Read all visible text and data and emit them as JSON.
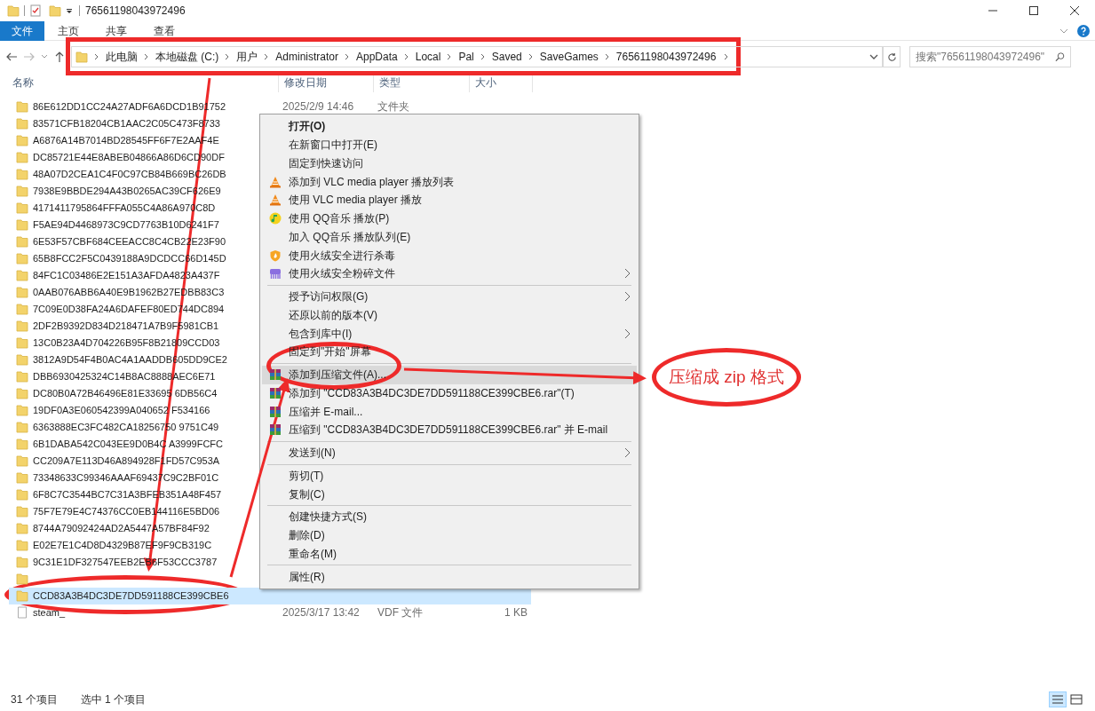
{
  "window": {
    "title": "76561198043972496"
  },
  "ribbon_tabs": [
    {
      "label": "文件",
      "selected": true
    },
    {
      "label": "主页",
      "selected": false
    },
    {
      "label": "共享",
      "selected": false
    },
    {
      "label": "查看",
      "selected": false
    }
  ],
  "address": {
    "crumbs": [
      "此电脑",
      "本地磁盘 (C:)",
      "用户",
      "Administrator",
      "AppData",
      "Local",
      "Pal",
      "Saved",
      "SaveGames",
      "76561198043972496"
    ]
  },
  "search": {
    "placeholder": "搜索\"76561198043972496\""
  },
  "columns": [
    "名称",
    "修改日期",
    "类型",
    "大小"
  ],
  "files": [
    {
      "kind": "folder",
      "name": "86E612DD1CC24A27ADF6A6DCD1B91752",
      "date": "2025/2/9 14:46",
      "type": "文件夹",
      "selected": false
    },
    {
      "kind": "folder",
      "name": "83571CFB18204CB1AAC2C05C473F8733",
      "selected": false
    },
    {
      "kind": "folder",
      "name": "A6876A14B7014BD28545FF6F7E2AAF4E",
      "selected": false
    },
    {
      "kind": "folder",
      "name": "DC85721E44E8ABEB04866A86D6CD90DF",
      "selected": false
    },
    {
      "kind": "folder",
      "name": "48A07D2CEA1C4F0C97CB84B669BC26DB",
      "selected": false
    },
    {
      "kind": "folder",
      "name": "7938E9BBDE294A43B0265AC39CF626E9",
      "selected": false
    },
    {
      "kind": "folder",
      "name": "4171411795864FFFA055C4A86A970C8D",
      "selected": false
    },
    {
      "kind": "folder",
      "name": "F5AE94D4468973C9CD7763B10D6241F7",
      "selected": false
    },
    {
      "kind": "folder",
      "name": "6E53F57CBF684CEEACC8C4CB22E23F90",
      "selected": false
    },
    {
      "kind": "folder",
      "name": "65B8FCC2F5C0439188A9DCDCC66D145D",
      "selected": false
    },
    {
      "kind": "folder",
      "name": "84FC1C03486E2E151A3AFDA4823A437F",
      "selected": false
    },
    {
      "kind": "folder",
      "name": "0AAB076ABB6A40E9B1962B27EDBB83C3",
      "selected": false
    },
    {
      "kind": "folder",
      "name": "7C09E0D38FA24A6DAFEF80ED744DC894",
      "selected": false
    },
    {
      "kind": "folder",
      "name": "2DF2B9392D834D218471A7B9F5981CB1",
      "selected": false
    },
    {
      "kind": "folder",
      "name": "13C0B23A4D704226B95F8B21809CCD03",
      "selected": false
    },
    {
      "kind": "folder",
      "name": "3812A9D54F4B0AC4A1AADDB605DD9CE2",
      "selected": false
    },
    {
      "kind": "folder",
      "name": "DBB6930425324C14B8AC8888AEC6E71",
      "selected": false
    },
    {
      "kind": "folder",
      "name": "DC80B0A72B46496E81E33695 6DB56C4",
      "selected": false
    },
    {
      "kind": "folder",
      "name": "19DF0A3E060542399A040652 F534166",
      "selected": false
    },
    {
      "kind": "folder",
      "name": "6363888EC3FC482CA18256750 9751C49",
      "selected": false
    },
    {
      "kind": "folder",
      "name": "6B1DABA542C043EE9D0B4C A3999FCFC",
      "selected": false
    },
    {
      "kind": "folder",
      "name": "CC209A7E113D46A894928F1FD57C953A",
      "selected": false
    },
    {
      "kind": "folder",
      "name": "73348633C99346AAAF69437C9C2BF01C",
      "selected": false
    },
    {
      "kind": "folder",
      "name": "6F8C7C3544BC7C31A3BFEB351A48F457",
      "selected": false
    },
    {
      "kind": "folder",
      "name": "75F7E79E4C74376CC0EB144116E5BD06",
      "selected": false
    },
    {
      "kind": "folder",
      "name": "8744A79092424AD2A5447A57BF84F92",
      "selected": false
    },
    {
      "kind": "folder",
      "name": "E02E7E1C4D8D4329B87EF9F9CB319C",
      "selected": false
    },
    {
      "kind": "folder",
      "name": "9C31E1DF327547EEB2EB6F53CCC3787",
      "selected": false
    },
    {
      "kind": "folder",
      "selected": false
    },
    {
      "kind": "folder",
      "name": "CCD83A3B4DC3DE7DD591188CE399CBE6",
      "selected": true
    },
    {
      "kind": "file",
      "name": "steam_",
      "date": "2025/3/17 13:42",
      "type": "VDF 文件",
      "size": "1 KB",
      "selected": false
    }
  ],
  "context_menu": {
    "items": [
      {
        "kind": "plain",
        "label": "打开(O)",
        "default": true,
        "submenu": false,
        "selected": false
      },
      {
        "kind": "plain",
        "label": "在新窗口中打开(E)",
        "default": false,
        "submenu": false,
        "selected": false
      },
      {
        "kind": "plain",
        "label": "固定到快速访问",
        "default": false,
        "submenu": false,
        "selected": false
      },
      {
        "kind": "cone",
        "label": "添加到 VLC media player 播放列表",
        "default": false,
        "submenu": false,
        "selected": false
      },
      {
        "kind": "cone",
        "label": "使用 VLC media player 播放",
        "default": false,
        "submenu": false,
        "selected": false
      },
      {
        "kind": "note",
        "label": "使用 QQ音乐 播放(P)",
        "default": false,
        "submenu": false,
        "selected": false
      },
      {
        "kind": "plain",
        "label": "加入 QQ音乐 播放队列(E)",
        "default": false,
        "submenu": false,
        "selected": false
      },
      {
        "kind": "shield",
        "label": "使用火绒安全进行杀毒",
        "default": false,
        "submenu": false,
        "selected": false
      },
      {
        "kind": "shredder",
        "label": "使用火绒安全粉碎文件",
        "default": false,
        "submenu": true,
        "selected": false
      },
      {
        "kind": "separator"
      },
      {
        "kind": "plain",
        "label": "授予访问权限(G)",
        "default": false,
        "submenu": true,
        "selected": false
      },
      {
        "kind": "plain",
        "label": "还原以前的版本(V)",
        "default": false,
        "submenu": false,
        "selected": false
      },
      {
        "kind": "plain",
        "label": "包含到库中(I)",
        "default": false,
        "submenu": true,
        "selected": false
      },
      {
        "kind": "plain",
        "label": "固定到\"开始\"屏幕",
        "default": false,
        "submenu": false,
        "selected": false
      },
      {
        "kind": "separator"
      },
      {
        "kind": "archive",
        "label": "添加到压缩文件(A)...",
        "default": false,
        "submenu": false,
        "selected": true
      },
      {
        "kind": "archive",
        "label": "添加到 \"CCD83A3B4DC3DE7DD591188CE399CBE6.rar\"(T)",
        "default": false,
        "submenu": false,
        "selected": false
      },
      {
        "kind": "archive",
        "label": "压缩并 E-mail...",
        "default": false,
        "submenu": false,
        "selected": false
      },
      {
        "kind": "archive",
        "label": "压缩到 \"CCD83A3B4DC3DE7DD591188CE399CBE6.rar\" 并 E-mail",
        "default": false,
        "submenu": false,
        "selected": false
      },
      {
        "kind": "separator"
      },
      {
        "kind": "plain",
        "label": "发送到(N)",
        "default": false,
        "submenu": true,
        "selected": false
      },
      {
        "kind": "separator"
      },
      {
        "kind": "plain",
        "label": "剪切(T)",
        "default": false,
        "submenu": false,
        "selected": false
      },
      {
        "kind": "plain",
        "label": "复制(C)",
        "default": false,
        "submenu": false,
        "selected": false
      },
      {
        "kind": "separator"
      },
      {
        "kind": "plain",
        "label": "创建快捷方式(S)",
        "default": false,
        "submenu": false,
        "selected": false
      },
      {
        "kind": "plain",
        "label": "删除(D)",
        "default": false,
        "submenu": false,
        "selected": false
      },
      {
        "kind": "plain",
        "label": "重命名(M)",
        "default": false,
        "submenu": false,
        "selected": false
      },
      {
        "kind": "separator"
      },
      {
        "kind": "plain",
        "label": "属性(R)",
        "default": false,
        "submenu": false,
        "selected": false
      }
    ]
  },
  "annotation": {
    "callout": "压缩成 zip 格式"
  },
  "status_bar": {
    "count": "31 个项目",
    "selection": "选中 1 个项目"
  }
}
